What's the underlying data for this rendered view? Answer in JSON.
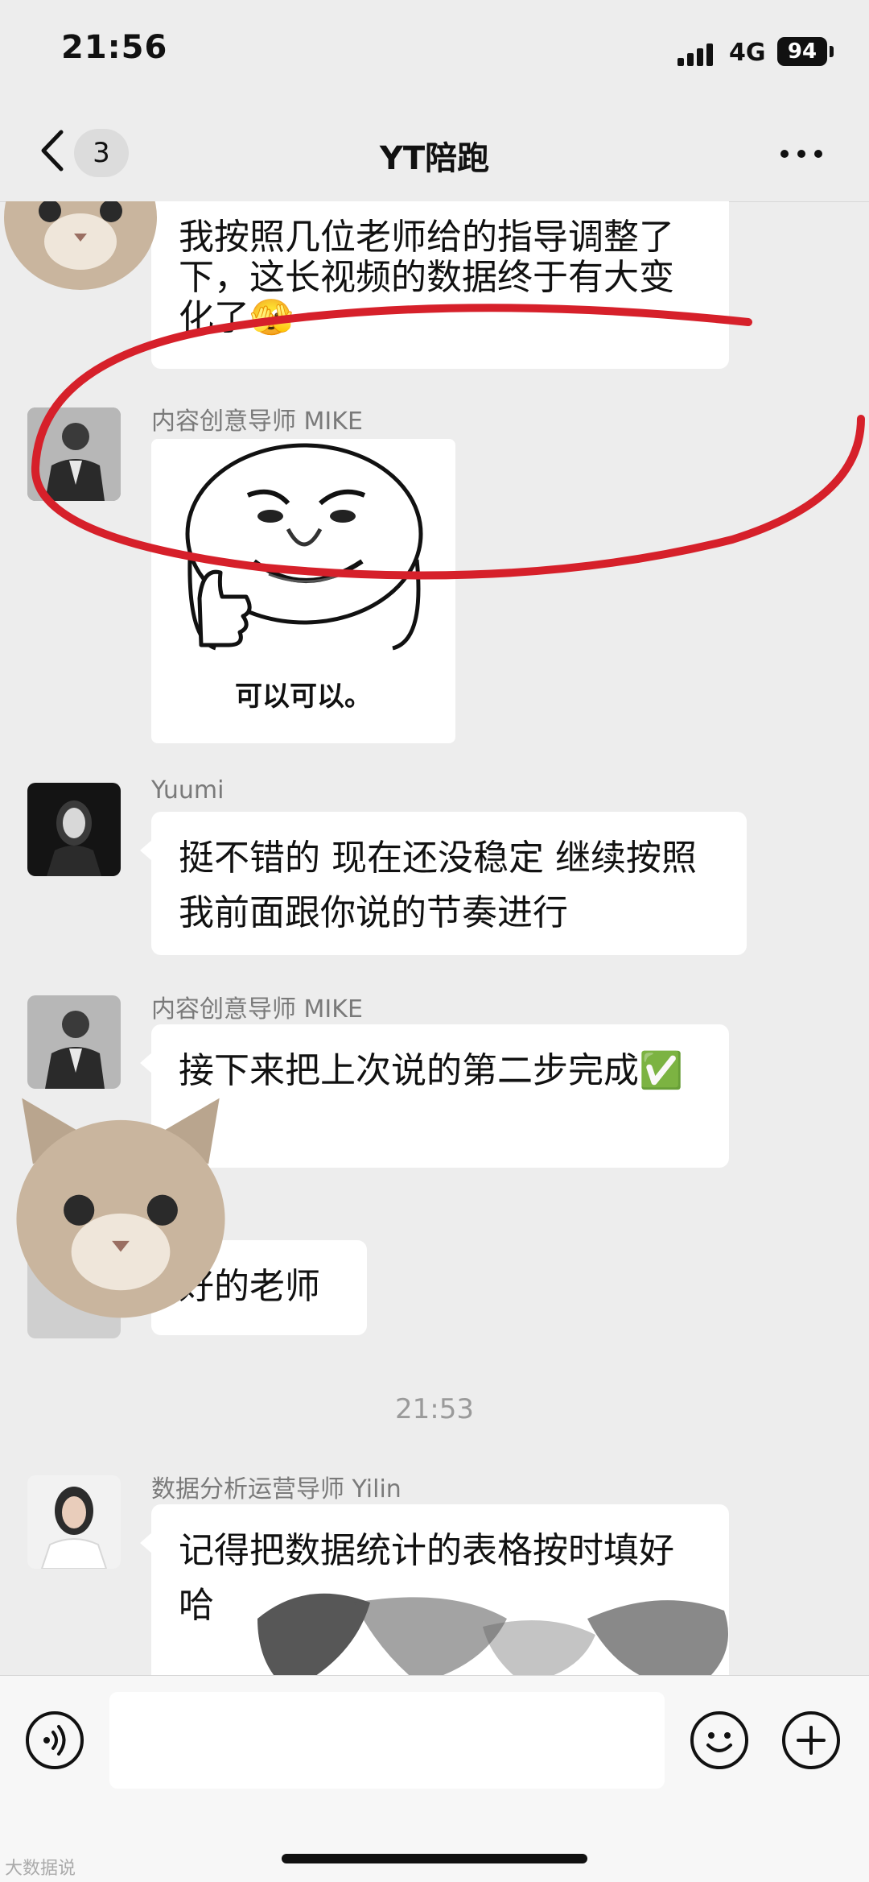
{
  "status_bar": {
    "time": "21:56",
    "network": "4G",
    "battery": "94"
  },
  "nav": {
    "unread_count": "3",
    "title": "YT陪跑"
  },
  "messages": [
    {
      "sender": "",
      "text": "我按照几位老师给的指导调整了下，这长视频的数据终于有大变化了🫣"
    },
    {
      "sender": "内容创意导师 MIKE",
      "sticker_caption": "可以可以。"
    },
    {
      "sender": "Yuumi",
      "text": "挺不错的 现在还没稳定 继续按照我前面跟你说的节奏进行"
    },
    {
      "sender": "内容创意导师 MIKE",
      "text": "接下来把上次说的第二步完成✅"
    },
    {
      "sender": "",
      "text": "好的老师"
    },
    {
      "sender": "数据分析运营导师 Yilin",
      "text": "记得把数据统计的表格按时填好哈"
    }
  ],
  "timestamp": "21:53",
  "watermark": "大数据说",
  "colors": {
    "background": "#ededed",
    "bubble": "#ffffff",
    "highlight": "#d6202a",
    "check": "#2fb556"
  },
  "icons": [
    "back-chevron-icon",
    "more-dots-icon",
    "voice-icon",
    "emoji-icon",
    "plus-icon",
    "cat-sticker-icon"
  ]
}
